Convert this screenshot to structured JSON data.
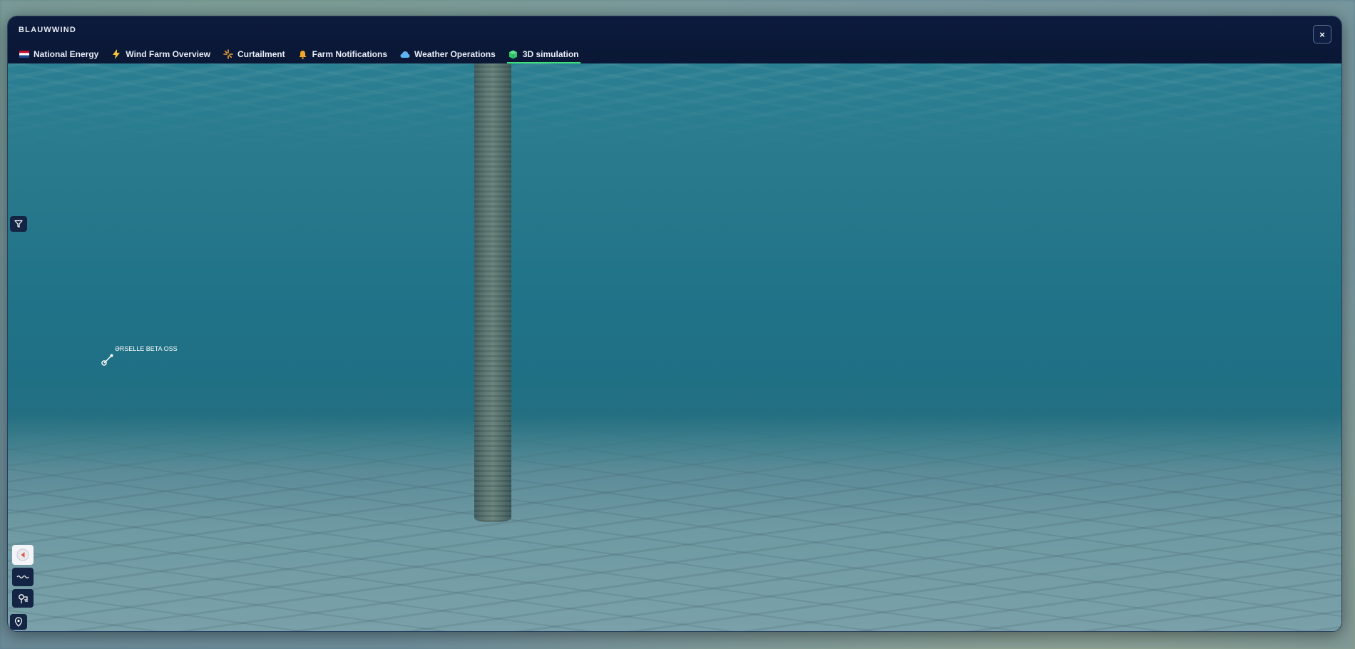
{
  "app": {
    "title": "BLAUWWIND",
    "close_label": "×"
  },
  "tabs": [
    {
      "label": "National Energy",
      "icon": "netherlands-flag-icon",
      "active": false
    },
    {
      "label": "Wind Farm Overview",
      "icon": "lightning-icon",
      "active": false
    },
    {
      "label": "Curtailment",
      "icon": "curtailment-icon",
      "active": false
    },
    {
      "label": "Farm Notifications",
      "icon": "bell-icon",
      "active": false
    },
    {
      "label": "Weather Operations",
      "icon": "cloud-icon",
      "active": false
    },
    {
      "label": "3D simulation",
      "icon": "cube-icon",
      "active": true
    }
  ],
  "scene": {
    "marker_label": "ƏRSELLE BETA OSS"
  },
  "tools": {
    "filter": "filter-icon",
    "sound": "sound-icon",
    "waves": "waves-icon",
    "turbine": "turbine-icon",
    "pin": "location-pin-icon"
  },
  "colors": {
    "header_bg": "#0c1a3c",
    "active_tab_underline": "#3ee07a",
    "water": "#217388",
    "seabed": "#7aa1aa"
  }
}
